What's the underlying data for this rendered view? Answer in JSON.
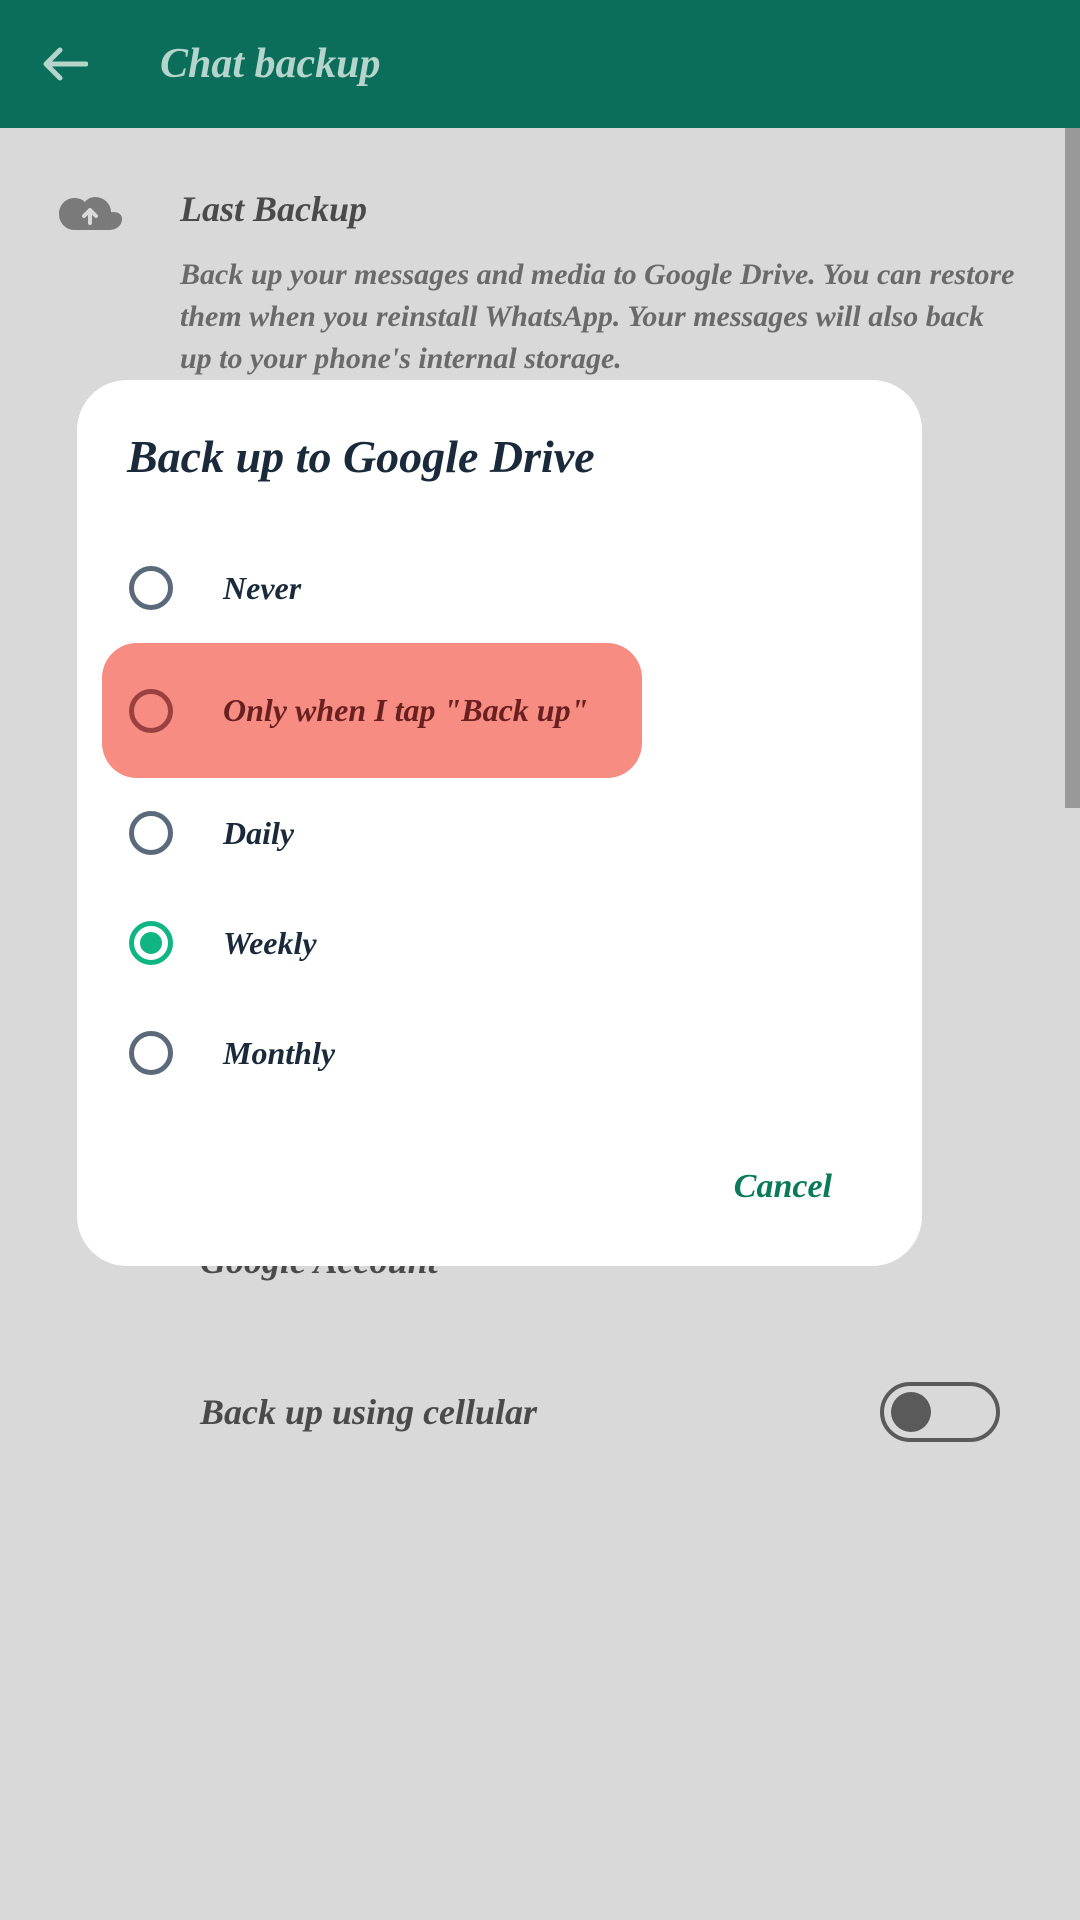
{
  "header": {
    "title": "Chat backup"
  },
  "backup_section": {
    "title": "Last Backup",
    "description": "Back up your messages and media to Google Drive. You can restore them when you reinstall WhatsApp. Your messages will also back up to your phone's internal storage."
  },
  "google_account_label": "Google Account",
  "cellular_toggle_label": "Back up using cellular",
  "dialog": {
    "title": "Back up to Google Drive",
    "options": [
      {
        "label": "Never",
        "selected": false,
        "highlighted": false
      },
      {
        "label": "Only when I tap \"Back up\"",
        "selected": false,
        "highlighted": true
      },
      {
        "label": "Daily",
        "selected": false,
        "highlighted": false
      },
      {
        "label": "Weekly",
        "selected": true,
        "highlighted": false
      },
      {
        "label": "Monthly",
        "selected": false,
        "highlighted": false
      }
    ],
    "cancel_label": "Cancel"
  }
}
